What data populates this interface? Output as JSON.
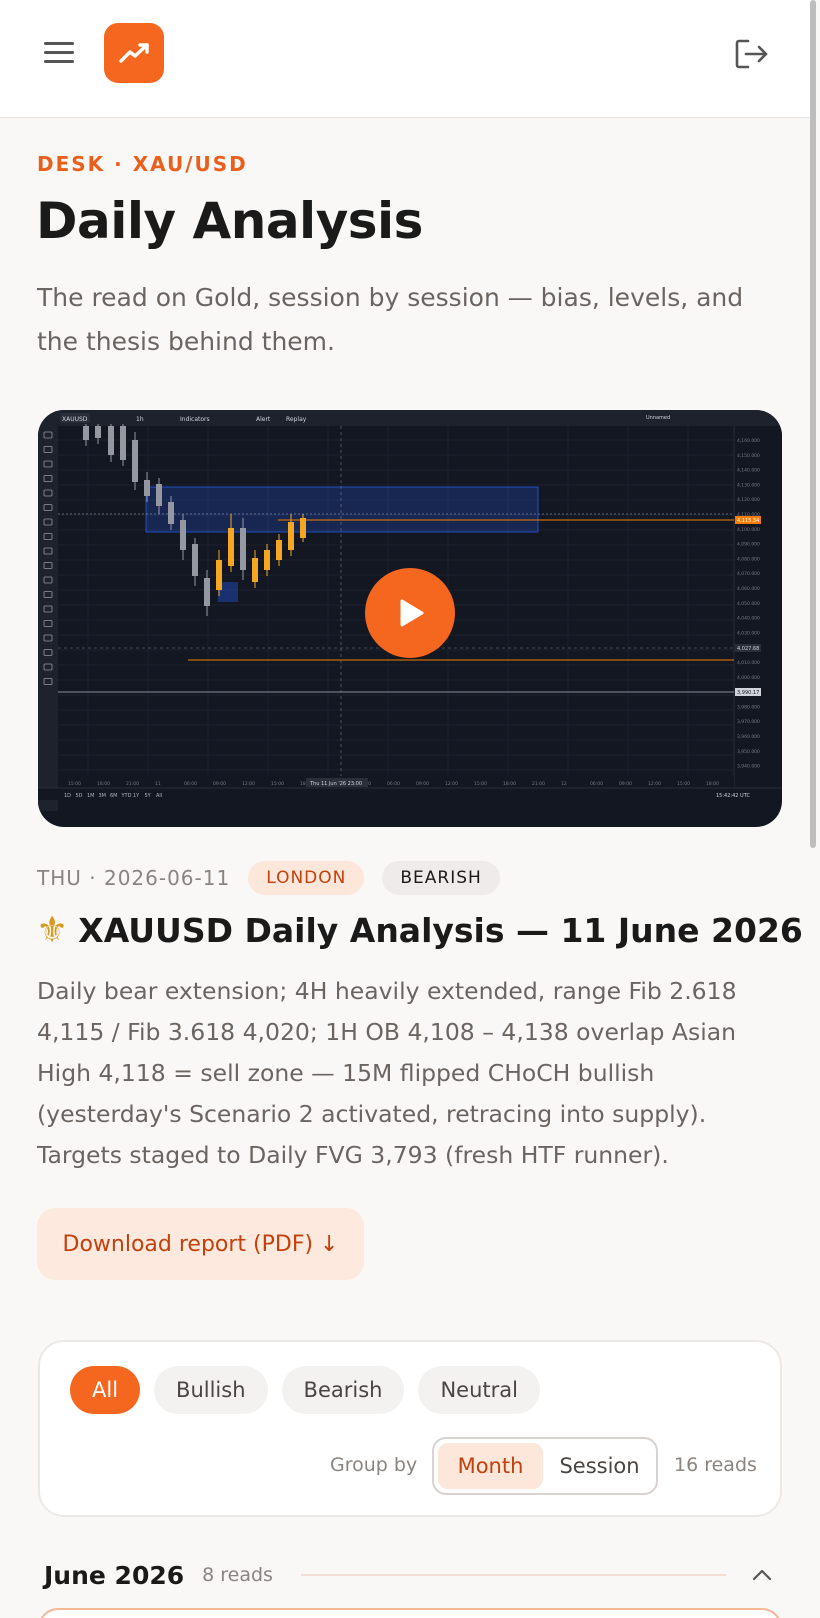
{
  "header": {
    "menu_icon": "hamburger-icon",
    "logo_icon": "trend-up-icon",
    "logout_icon": "logout-icon",
    "brand_color": "#f5661f"
  },
  "intro": {
    "eyebrow": "DESK · XAU/USD",
    "title": "Daily Analysis",
    "subtitle": "The read on Gold, session by session — bias, levels, and the thesis behind them."
  },
  "featured": {
    "video": {
      "symbol": "XAUUSD",
      "timeframe": "1h",
      "toolbar": [
        "Indicators",
        "Alert",
        "Replay"
      ],
      "layout_name": "Unnamed",
      "range_buttons": [
        "1D",
        "5D",
        "1M",
        "3M",
        "6M",
        "YTD",
        "1Y",
        "5Y",
        "All"
      ],
      "clock": "15:42:42 UTC",
      "cursor_date": "Thu 11 Jun '26  23:00",
      "price_ticks": [
        "4,160.000",
        "4,150.000",
        "4,140.000",
        "4,130.000",
        "4,120.000",
        "4,110.000",
        "4,100.000",
        "4,090.000",
        "4,080.000",
        "4,070.000",
        "4,060.000",
        "4,050.000",
        "4,040.000",
        "4,030.000",
        "4,020.000",
        "4,010.000",
        "4,000.000",
        "3,990.000",
        "3,980.000",
        "3,970.000",
        "3,960.000",
        "3,950.000",
        "3,940.000"
      ],
      "time_ticks": [
        "15:00",
        "18:00",
        "21:00",
        "11",
        "06:00",
        "09:00",
        "12:00",
        "15:00",
        "18:00",
        "21:00",
        "03:00",
        "06:00",
        "09:00",
        "12:00",
        "15:00",
        "18:00",
        "21:00",
        "12",
        "06:00",
        "09:00",
        "12:00",
        "15:00",
        "18:00"
      ],
      "price_tags": [
        "4,115.34",
        "4,027.68",
        "3,990.17"
      ],
      "play_icon": "play-icon"
    },
    "date": "THU · 2026-06-11",
    "session": "LONDON",
    "bias": "BEARISH",
    "title_icon": "fleur-de-lis-icon",
    "title": "XAUUSD Daily Analysis — 11 June 2026",
    "summary": "Daily bear extension; 4H heavily extended, range Fib 2.618 4,115 / Fib 3.618 4,020; 1H OB 4,108 – 4,138 overlap Asian High 4,118 = sell zone — 15M flipped CHoCH bullish (yesterday's Scenario 2 activated, retracing into supply). Targets staged to Daily FVG 3,793 (fresh HTF runner).",
    "download_label": "Download report (PDF) ↓"
  },
  "filters": {
    "chips": [
      "All",
      "Bullish",
      "Bearish",
      "Neutral"
    ],
    "active_chip": "All",
    "group_by_label": "Group by",
    "group_options": [
      "Month",
      "Session"
    ],
    "active_group": "Month",
    "reads_count": "16 reads"
  },
  "groups": [
    {
      "title": "June 2026",
      "count": "8 reads",
      "expanded": true,
      "toggle_icon": "chevron-up-icon"
    }
  ]
}
